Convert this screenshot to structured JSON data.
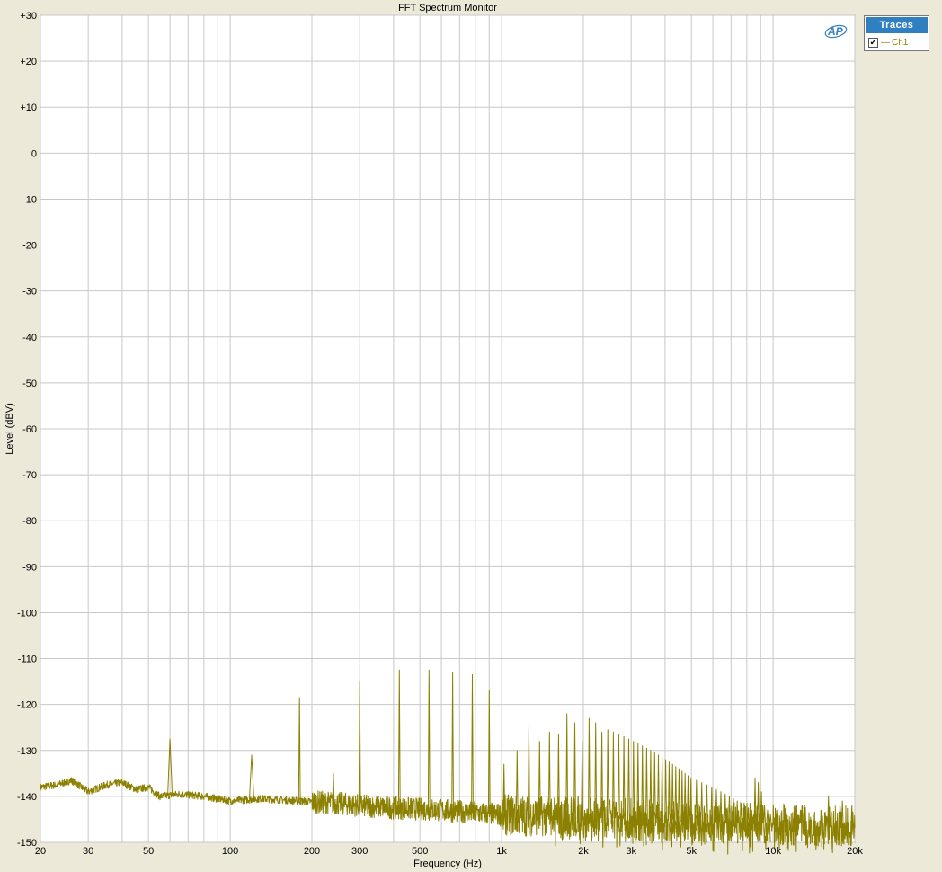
{
  "window_title": "FFT Spectrum Monitor",
  "traces_panel": {
    "header": "Traces",
    "items": [
      {
        "label": "Ch1",
        "checked": true,
        "color": "#8b8000"
      }
    ]
  },
  "logo_text": "AP",
  "colors": {
    "trace": "#8b8000",
    "grid": "#c8c8c8",
    "frame_bg": "#ece9d8",
    "plot_bg": "#ffffff",
    "legend_header": "#2f7fc1"
  },
  "chart_data": {
    "type": "line",
    "title": "FFT Spectrum Monitor",
    "xlabel": "Frequency (Hz)",
    "ylabel": "Level (dBV)",
    "xscale": "log",
    "xlim": [
      20,
      20000
    ],
    "ylim": [
      -150,
      30
    ],
    "grid": true,
    "legend": "right",
    "x_ticks": [
      {
        "v": 20,
        "t": "20"
      },
      {
        "v": 30,
        "t": "30"
      },
      {
        "v": 50,
        "t": "50"
      },
      {
        "v": 100,
        "t": "100"
      },
      {
        "v": 200,
        "t": "200"
      },
      {
        "v": 300,
        "t": "300"
      },
      {
        "v": 500,
        "t": "500"
      },
      {
        "v": 1000,
        "t": "1k"
      },
      {
        "v": 2000,
        "t": "2k"
      },
      {
        "v": 3000,
        "t": "3k"
      },
      {
        "v": 5000,
        "t": "5k"
      },
      {
        "v": 10000,
        "t": "10k"
      },
      {
        "v": 20000,
        "t": "20k"
      }
    ],
    "y_ticks": [
      {
        "v": 30,
        "t": "+30"
      },
      {
        "v": 20,
        "t": "+20"
      },
      {
        "v": 10,
        "t": "+10"
      },
      {
        "v": 0,
        "t": "0"
      },
      {
        "v": -10,
        "t": "-10"
      },
      {
        "v": -20,
        "t": "-20"
      },
      {
        "v": -30,
        "t": "-30"
      },
      {
        "v": -40,
        "t": "-40"
      },
      {
        "v": -50,
        "t": "-50"
      },
      {
        "v": -60,
        "t": "-60"
      },
      {
        "v": -70,
        "t": "-70"
      },
      {
        "v": -80,
        "t": "-80"
      },
      {
        "v": -90,
        "t": "-90"
      },
      {
        "v": -100,
        "t": "-100"
      },
      {
        "v": -110,
        "t": "-110"
      },
      {
        "v": -120,
        "t": "-120"
      },
      {
        "v": -130,
        "t": "-130"
      },
      {
        "v": -140,
        "t": "-140"
      },
      {
        "v": -150,
        "t": "-150"
      }
    ],
    "series": [
      {
        "name": "Ch1",
        "floor": [
          [
            20,
            -138
          ],
          [
            23,
            -137.5
          ],
          [
            26,
            -136.5
          ],
          [
            30,
            -139
          ],
          [
            35,
            -137.5
          ],
          [
            40,
            -137
          ],
          [
            45,
            -138.5
          ],
          [
            50,
            -138
          ],
          [
            55,
            -140
          ],
          [
            65,
            -139.5
          ],
          [
            80,
            -140
          ],
          [
            100,
            -141
          ],
          [
            130,
            -140.5
          ],
          [
            180,
            -141
          ],
          [
            250,
            -141.5
          ],
          [
            300,
            -142
          ],
          [
            400,
            -142.5
          ],
          [
            600,
            -143
          ],
          [
            1000,
            -144
          ],
          [
            2000,
            -144.5
          ],
          [
            5000,
            -145.5
          ],
          [
            10000,
            -146
          ],
          [
            20000,
            -146.5
          ]
        ],
        "peaks": [
          [
            60,
            -127.5
          ],
          [
            120,
            -131
          ],
          [
            180,
            -118.5
          ],
          [
            240,
            -135
          ],
          [
            300,
            -115
          ],
          [
            420,
            -112.5
          ],
          [
            540,
            -112.5
          ],
          [
            660,
            -113
          ],
          [
            780,
            -113.5
          ],
          [
            900,
            -117
          ],
          [
            1020,
            -133
          ],
          [
            1140,
            -130
          ],
          [
            1260,
            -125
          ],
          [
            1380,
            -128
          ],
          [
            1500,
            -126
          ],
          [
            1620,
            -126.5
          ],
          [
            1740,
            -122
          ],
          [
            1860,
            -124
          ],
          [
            1980,
            -128
          ],
          [
            2100,
            -123
          ],
          [
            2220,
            -124
          ],
          [
            2340,
            -126
          ],
          [
            2460,
            -125.5
          ],
          [
            2580,
            -126
          ],
          [
            2700,
            -126.5
          ],
          [
            2820,
            -127
          ],
          [
            2940,
            -127.5
          ],
          [
            3060,
            -128
          ],
          [
            3180,
            -128.5
          ],
          [
            3300,
            -129
          ],
          [
            3420,
            -129.5
          ],
          [
            3540,
            -130
          ],
          [
            3660,
            -130.5
          ],
          [
            3780,
            -131
          ],
          [
            3900,
            -131.5
          ],
          [
            4020,
            -132
          ],
          [
            4140,
            -132.5
          ],
          [
            4260,
            -133
          ],
          [
            4380,
            -133.5
          ],
          [
            4500,
            -134
          ],
          [
            4620,
            -134.5
          ],
          [
            4740,
            -135
          ],
          [
            4860,
            -135.5
          ],
          [
            4980,
            -136
          ],
          [
            5220,
            -136.5
          ],
          [
            5460,
            -137
          ],
          [
            5700,
            -137.5
          ],
          [
            5940,
            -138
          ],
          [
            6180,
            -138.5
          ],
          [
            6420,
            -139
          ],
          [
            6660,
            -139.5
          ],
          [
            6900,
            -140
          ],
          [
            7140,
            -140.5
          ],
          [
            7380,
            -141
          ],
          [
            7620,
            -141.5
          ],
          [
            7860,
            -142
          ],
          [
            8100,
            -142.5
          ],
          [
            8340,
            -143
          ],
          [
            8580,
            -136
          ],
          [
            8820,
            -137
          ],
          [
            9060,
            -139
          ],
          [
            9300,
            -142
          ],
          [
            9540,
            -143
          ],
          [
            9780,
            -144
          ],
          [
            16000,
            -140
          ],
          [
            18000,
            -141
          ],
          [
            19500,
            -142
          ]
        ]
      }
    ]
  }
}
